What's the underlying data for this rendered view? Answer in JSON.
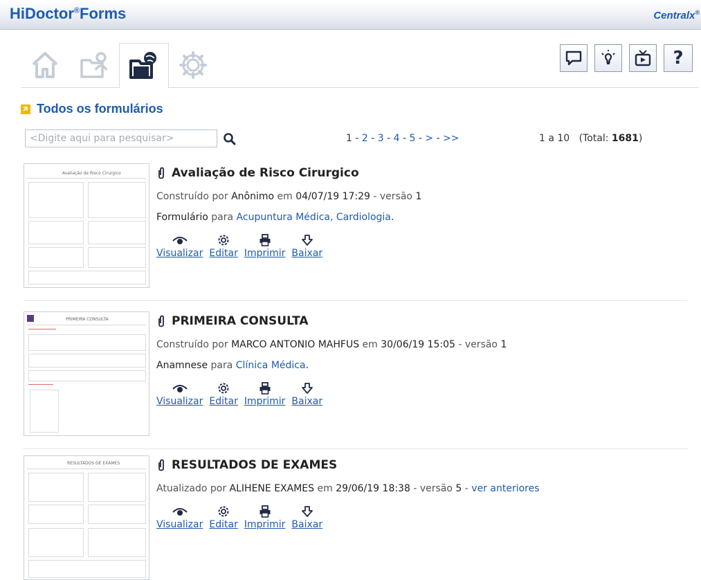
{
  "app": {
    "brand": "HiDoctor",
    "brand_mark": "®",
    "brand_suffix": "Forms",
    "vendor": "Centralx",
    "vendor_mark": "®"
  },
  "tabs": [
    {
      "icon": "home-icon"
    },
    {
      "icon": "user-folder-icon"
    },
    {
      "icon": "forms-folder-icon",
      "active": true
    },
    {
      "icon": "settings-gear-icon"
    }
  ],
  "toolbar": [
    {
      "icon": "chat-bubble-icon"
    },
    {
      "icon": "lightbulb-icon"
    },
    {
      "icon": "tv-video-icon"
    },
    {
      "icon": "help-question-icon",
      "label": "?"
    }
  ],
  "section": {
    "title": "Todos os formulários"
  },
  "search": {
    "placeholder": "<Digite aqui para pesquisar>"
  },
  "pagination": {
    "current": "1",
    "sep": " - ",
    "pages": [
      "2",
      "3",
      "4",
      "5",
      ">",
      ">>"
    ],
    "range": "1 a 10",
    "total_label": "(Total: ",
    "total": "1681",
    "total_close": ")"
  },
  "actions_labels": {
    "view": "Visualizar",
    "edit": "Editar",
    "print": "Imprimir",
    "download": "Baixar"
  },
  "forms": [
    {
      "title": "Avaliação de Risco Cirurgico",
      "verb": "Construído por",
      "author": "Anônimo",
      "on": "em",
      "date": "04/07/19 17:29",
      "version_label": "- versão",
      "version": "1",
      "type": "Formulário",
      "para": "para",
      "specialties": "Acupuntura Médica, Cardiologia",
      "end": ".",
      "thumb_title": "Avaliação de Risco Cirurgico"
    },
    {
      "title": "PRIMEIRA CONSULTA",
      "verb": "Construído por",
      "author": "MARCO ANTONIO MAHFUS",
      "on": "em",
      "date": "30/06/19 15:05",
      "version_label": "- versão",
      "version": "1",
      "type": "Anamnese",
      "para": "para",
      "specialties": "Clínica Médica",
      "end": ".",
      "thumb_title": "PRIMEIRA CONSULTA"
    },
    {
      "title": "RESULTADOS DE EXAMES",
      "verb": "Atualizado por",
      "author": "ALIHENE EXAMES",
      "on": "em",
      "date": "29/06/19 18:38",
      "version_label": "- versão",
      "version": "5",
      "history_sep": " - ",
      "history_link": "ver anteriores",
      "thumb_title": "RESULTADOS DE EXAMES"
    }
  ],
  "colors": {
    "brand_blue": "#1d5bb0",
    "accent_yellow": "#f2b705",
    "text": "#333333"
  }
}
